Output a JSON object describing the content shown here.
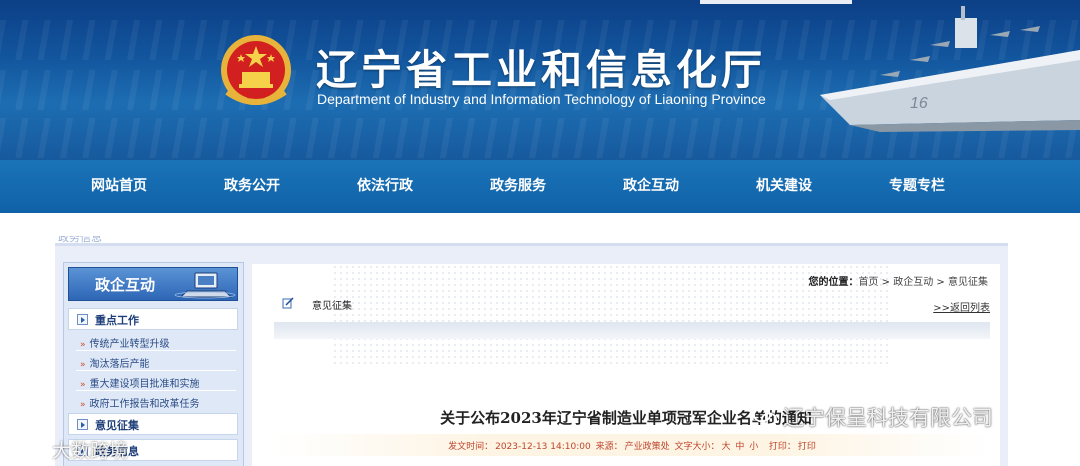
{
  "header": {
    "title_cn": "辽宁省工业和信息化厅",
    "title_en": "Department of Industry and Information Technology of Liaoning Province",
    "emblem": "national-emblem-icon"
  },
  "nav": {
    "items": [
      {
        "label": "网站首页"
      },
      {
        "label": "政务公开"
      },
      {
        "label": "依法行政"
      },
      {
        "label": "政务服务"
      },
      {
        "label": "政企互动"
      },
      {
        "label": "机关建设"
      },
      {
        "label": "专题专栏"
      }
    ]
  },
  "sidebar": {
    "title": "政企互动",
    "sections": [
      {
        "label": "重点工作",
        "items": [
          {
            "label": "传统产业转型升级"
          },
          {
            "label": "淘汰落后产能"
          },
          {
            "label": "重大建设项目批准和实施"
          },
          {
            "label": "政府工作报告和改革任务"
          }
        ]
      },
      {
        "label": "意见征集"
      },
      {
        "label": "政务信息"
      }
    ]
  },
  "breadcrumb": {
    "prefix": "您的位置：",
    "items": [
      "首页",
      "政企互动",
      "意见征集"
    ],
    "separator": " > "
  },
  "section": {
    "title": "意见征集",
    "back_label": ">>返回列表"
  },
  "article": {
    "title": "关于公布2023年辽宁省制造业单项冠军企业名单的通知",
    "meta": {
      "date_label": "发文时间：",
      "date": "2023-12-13 14:10:00",
      "source_label": "来源：",
      "source": "产业政策处",
      "fontsize_label": "文字大小：",
      "size_large": "大",
      "size_medium": "中",
      "size_small": "小",
      "print_label": "打印：",
      "print": "打印"
    }
  },
  "watermarks": {
    "right": "辽宁保呈科技有限公司",
    "left": "大数跨境"
  },
  "colors": {
    "banner": "#12559d",
    "nav": "#1468ad",
    "meta_text": "#c0452d",
    "sidebar_head": "#2d66b5"
  }
}
